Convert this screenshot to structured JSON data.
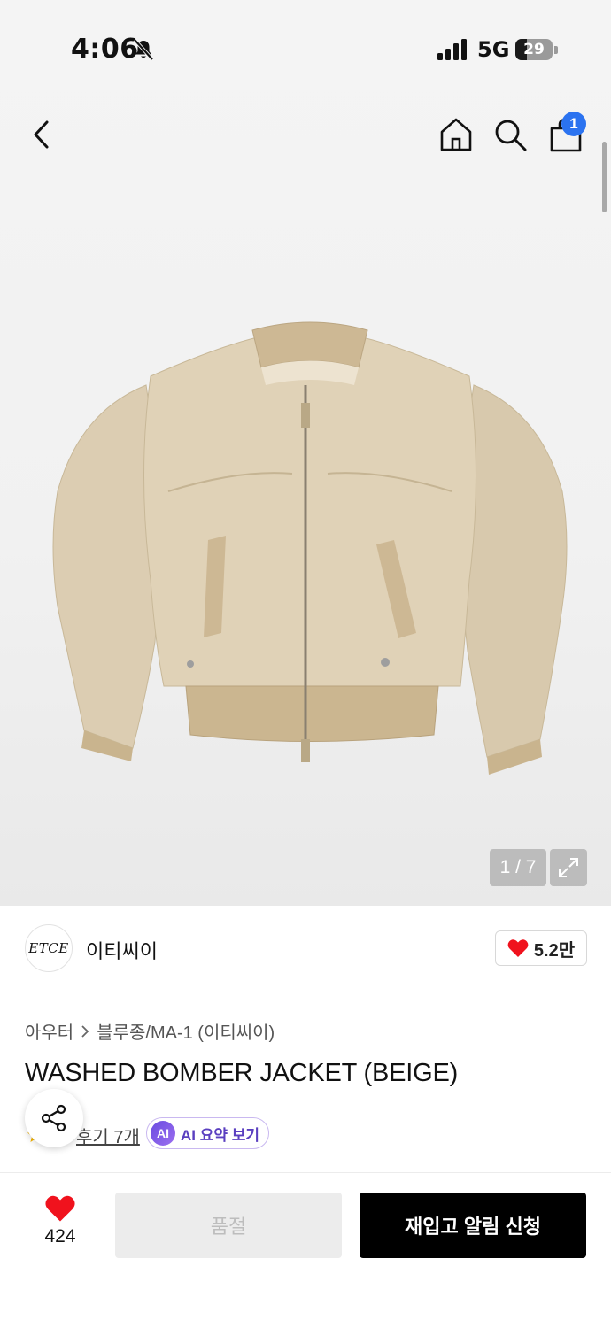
{
  "status_bar": {
    "time": "4:06",
    "network": "5G",
    "battery_level": "29"
  },
  "nav": {
    "cart_count": "1"
  },
  "gallery": {
    "counter": "1 / 7"
  },
  "brand": {
    "logo_text": "ETCE",
    "name": "이티씨이",
    "likes": "5.2만"
  },
  "breadcrumb": {
    "category": "아우터",
    "subcategory": "블루종/MA-1 (이티씨이)"
  },
  "product": {
    "title": "WASHED BOMBER JACKET (BEIGE)",
    "review_link": "후기 7개",
    "ai_badge": "AI",
    "ai_summary_label": "AI 요약 보기"
  },
  "bottom_bar": {
    "wish_count": "424",
    "soldout_label": "품절",
    "restock_label": "재입고 알림 신청"
  },
  "colors": {
    "accent_blue": "#2b73f0",
    "heart_red": "#f0121d",
    "ai_purple": "#6a4be0",
    "primary_black": "#000000"
  }
}
